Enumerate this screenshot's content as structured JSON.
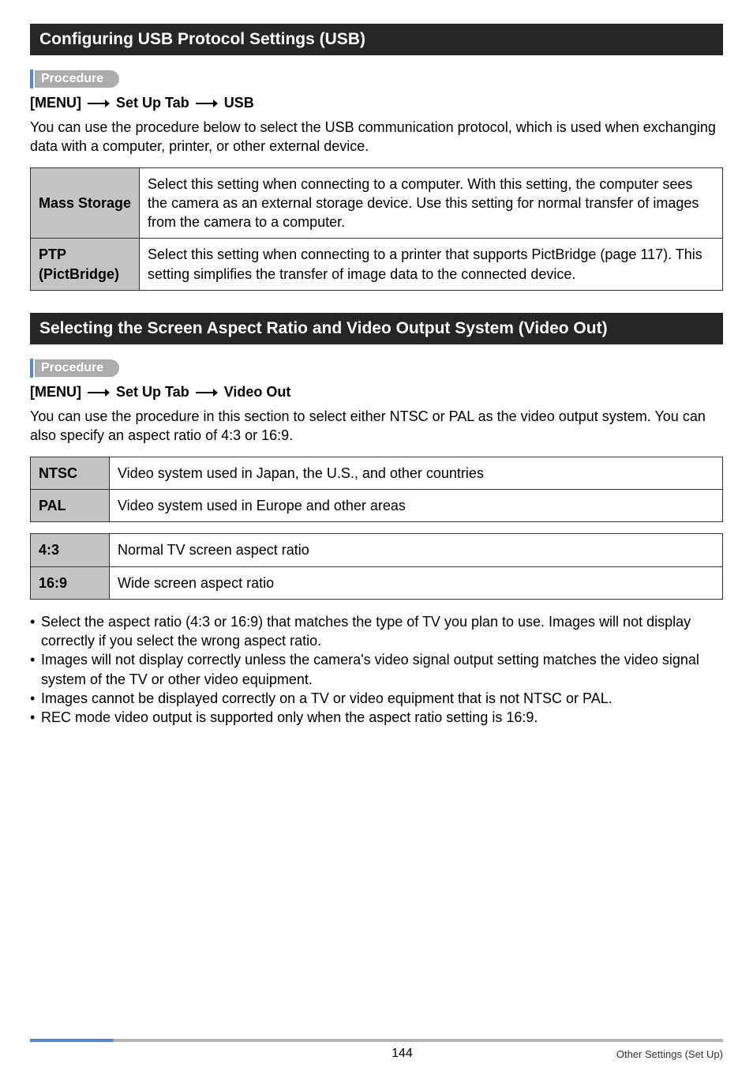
{
  "section1": {
    "title": "Configuring USB Protocol Settings (USB)",
    "procedure_label": "Procedure",
    "menu_path": [
      "[MENU]",
      "Set Up Tab",
      "USB"
    ],
    "para": "You can use the procedure below to select the USB communication protocol, which is used when exchanging data with a computer, printer, or other external device.",
    "table": [
      {
        "key": "Mass Storage",
        "val": "Select this setting when connecting to a computer. With this setting, the computer sees the camera as an external storage device. Use this setting for normal transfer of images from the camera to a computer."
      },
      {
        "key": "PTP\n(PictBridge)",
        "val": "Select this setting when connecting to a printer that supports PictBridge (page 117). This setting simplifies the transfer of image data to the connected device."
      }
    ]
  },
  "section2": {
    "title": "Selecting the Screen Aspect Ratio and Video Output System (Video Out)",
    "procedure_label": "Procedure",
    "menu_path": [
      "[MENU]",
      "Set Up Tab",
      "Video Out"
    ],
    "para": "You can use the procedure in this section to select either NTSC or PAL as the video output system. You can also specify an aspect ratio of 4:3 or 16:9.",
    "table1": [
      {
        "key": "NTSC",
        "val": "Video system used in Japan, the U.S., and other countries"
      },
      {
        "key": "PAL",
        "val": "Video system used in Europe and other areas"
      }
    ],
    "table2": [
      {
        "key": "4:3",
        "val": "Normal TV screen aspect ratio"
      },
      {
        "key": "16:9",
        "val": "Wide screen aspect ratio"
      }
    ],
    "bullets": [
      "Select the aspect ratio (4:3 or 16:9) that matches the type of TV you plan to use. Images will not display correctly if you select the wrong aspect ratio.",
      "Images will not display correctly unless the camera's video signal output setting matches the video signal system of the TV or other video equipment.",
      "Images cannot be displayed correctly on a TV or video equipment that is not NTSC or PAL.",
      "REC mode video output is supported only when the aspect ratio setting is 16:9."
    ]
  },
  "footer": {
    "page": "144",
    "section": "Other Settings (Set Up)"
  }
}
